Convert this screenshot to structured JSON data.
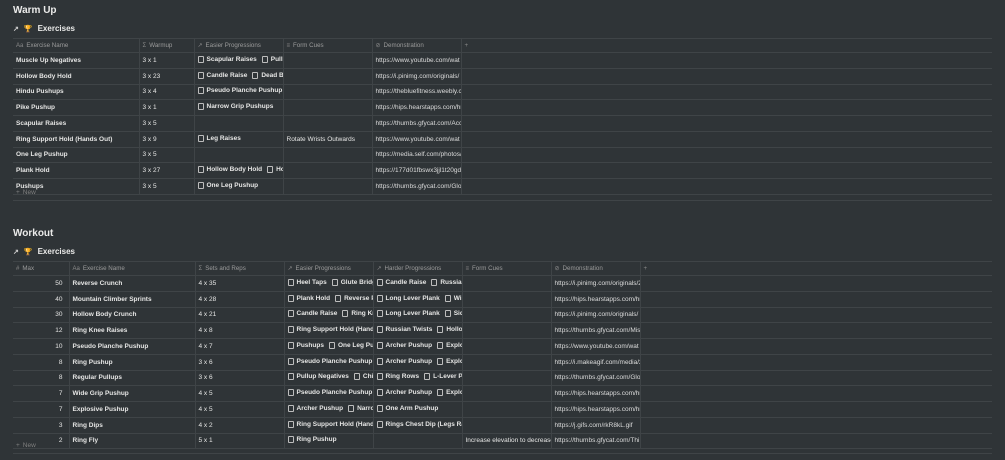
{
  "warmup": {
    "heading": "Warm Up",
    "db_title": "Exercises",
    "columns": {
      "name": "Exercise Name",
      "warmup": "Warmup",
      "easier": "Easier Progressions",
      "cues": "Form Cues",
      "demo": "Demonstration"
    },
    "new_label": "New",
    "rows": [
      {
        "name": "Muscle Up Negatives",
        "warmup": "3 x 1",
        "easier": [
          "Scapular Raises",
          "Pullu"
        ],
        "cues": "",
        "demo": "https://www.youtube.com/wat"
      },
      {
        "name": "Hollow Body Hold",
        "warmup": "3 x 23",
        "easier": [
          "Candle Raise",
          "Dead Bu"
        ],
        "cues": "",
        "demo": "https://i.pinimg.com/originals/"
      },
      {
        "name": "Hindu Pushups",
        "warmup": "3 x 4",
        "easier": [
          "Pseudo Planche Pushup"
        ],
        "cues": "",
        "demo": "https://thebluefitness.weebly.co"
      },
      {
        "name": "Pike Pushup",
        "warmup": "3 x 1",
        "easier": [
          "Narrow Grip Pushups"
        ],
        "cues": "",
        "demo": "https://hips.hearstapps.com/hr"
      },
      {
        "name": "Scapular Raises",
        "warmup": "3 x 5",
        "easier": [],
        "cues": "",
        "demo": "https://thumbs.gfycat.com/Acc"
      },
      {
        "name": "Ring Support Hold (Hands Out)",
        "warmup": "3 x 9",
        "easier": [
          "Leg Raises"
        ],
        "cues": "Rotate Wrists Outwards",
        "demo": "https://www.youtube.com/wat"
      },
      {
        "name": "One Leg Pushup",
        "warmup": "3 x 5",
        "easier": [],
        "cues": "",
        "demo": "https://media.self.com/photos/"
      },
      {
        "name": "Plank Hold",
        "warmup": "3 x 27",
        "easier": [
          "Hollow Body Hold",
          "Ho"
        ],
        "cues": "",
        "demo": "https://177d01fbswx3jjl1t20gdr"
      },
      {
        "name": "Pushups",
        "warmup": "3 x 5",
        "easier": [
          "One Leg Pushup"
        ],
        "cues": "",
        "demo": "https://thumbs.gfycat.com/Glo"
      }
    ]
  },
  "workout": {
    "heading": "Workout",
    "db_title": "Exercises",
    "columns": {
      "max": "Max",
      "name": "Exercise Name",
      "sets": "Sets and Reps",
      "easier": "Easier Progressions",
      "harder": "Harder Progressions",
      "cues": "Form Cues",
      "demo": "Demonstration"
    },
    "new_label": "New",
    "rows": [
      {
        "max": "50",
        "name": "Reverse Crunch",
        "sets": "4 x 35",
        "easier": [
          "Heel Taps",
          "Glute Bridg"
        ],
        "harder": [
          "Candle Raise",
          "Russian"
        ],
        "cues": "",
        "demo": "https://i.pinimg.com/originals/2"
      },
      {
        "max": "40",
        "name": "Mountain Climber Sprints",
        "sets": "4 x 28",
        "easier": [
          "Plank Hold",
          "Reverse P"
        ],
        "harder": [
          "Long Lever Plank",
          "Wir"
        ],
        "cues": "",
        "demo": "https://hips.hearstapps.com/hr"
      },
      {
        "max": "30",
        "name": "Hollow Body Crunch",
        "sets": "4 x 21",
        "easier": [
          "Candle Raise",
          "Ring Kn"
        ],
        "harder": [
          "Long Lever Plank",
          "Sid"
        ],
        "cues": "",
        "demo": "https://i.pinimg.com/originals/"
      },
      {
        "max": "12",
        "name": "Ring Knee Raises",
        "sets": "4 x 8",
        "easier": [
          "Ring Support Hold (Hands"
        ],
        "harder": [
          "Russian Twists",
          "Hollov"
        ],
        "cues": "",
        "demo": "https://thumbs.gfycat.com/Mis"
      },
      {
        "max": "10",
        "name": "Pseudo Planche Pushup",
        "sets": "4 x 7",
        "easier": [
          "Pushups",
          "One Leg Pu"
        ],
        "harder": [
          "Archer Pushup",
          "Explor"
        ],
        "cues": "",
        "demo": "https://www.youtube.com/wat"
      },
      {
        "max": "8",
        "name": "Ring Pushup",
        "sets": "3 x 6",
        "easier": [
          "Pseudo Planche Pushup"
        ],
        "harder": [
          "Archer Pushup",
          "Explo"
        ],
        "cues": "",
        "demo": "https://i.makeagif.com/media/2"
      },
      {
        "max": "8",
        "name": "Regular Pullups",
        "sets": "3 x 6",
        "easier": [
          "Pullup Negatives",
          "Chi"
        ],
        "harder": [
          "Ring Rows",
          "L-Lever Pu"
        ],
        "cues": "",
        "demo": "https://thumbs.gfycat.com/Glo"
      },
      {
        "max": "7",
        "name": "Wide Grip Pushup",
        "sets": "4 x 5",
        "easier": [
          "Pseudo Planche Pushup"
        ],
        "harder": [
          "Archer Pushup",
          "Explo"
        ],
        "cues": "",
        "demo": "https://hips.hearstapps.com/hr"
      },
      {
        "max": "7",
        "name": "Explosive Pushup",
        "sets": "4 x 5",
        "easier": [
          "Archer Pushup",
          "Narro"
        ],
        "harder": [
          "One Arm Pushup"
        ],
        "cues": "",
        "demo": "https://hips.hearstapps.com/hr"
      },
      {
        "max": "3",
        "name": "Ring Dips",
        "sets": "4 x 2",
        "easier": [
          "Ring Support Hold (Hands"
        ],
        "harder": [
          "Rings Chest Dip (Legs Rais"
        ],
        "cues": "",
        "demo": "https://j.gifs.com/rkR8kL.gif"
      },
      {
        "max": "2",
        "name": "Ring Fly",
        "sets": "5 x 1",
        "easier": [
          "Ring Pushup"
        ],
        "harder": [],
        "cues": "Increase elevation to decrease",
        "demo": "https://thumbs.gfycat.com/Thi"
      }
    ]
  }
}
